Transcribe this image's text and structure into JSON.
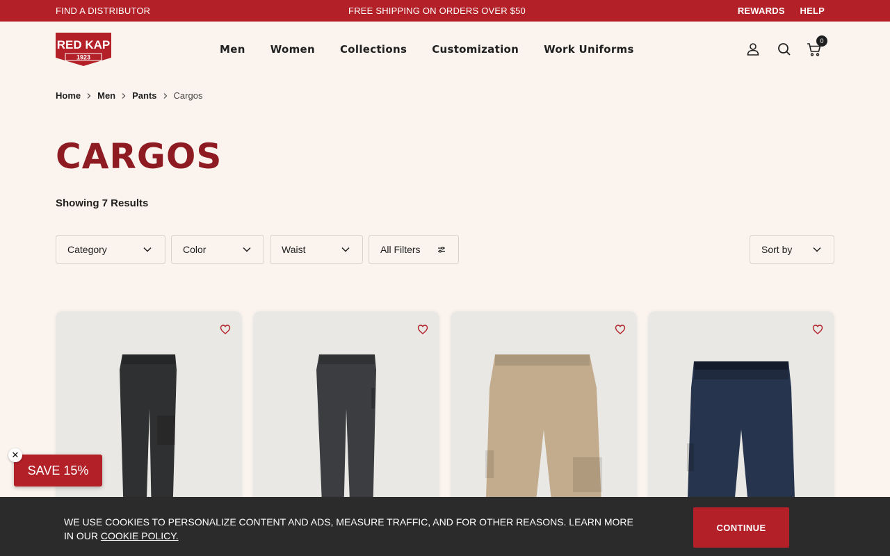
{
  "topbar": {
    "find_distributor": "FIND A DISTRIBUTOR",
    "shipping": "FREE SHIPPING ON ORDERS OVER $50",
    "rewards": "REWARDS",
    "help": "HELP"
  },
  "logo": {
    "line1": "RED KAP",
    "line2": "1923"
  },
  "nav": [
    "Men",
    "Women",
    "Collections",
    "Customization",
    "Work Uniforms"
  ],
  "cart": {
    "count": "0"
  },
  "breadcrumb": {
    "home": "Home",
    "men": "Men",
    "pants": "Pants",
    "current": "Cargos"
  },
  "page": {
    "title": "CARGOS",
    "results": "Showing 7 Results"
  },
  "filters": {
    "category": "Category",
    "color": "Color",
    "waist": "Waist",
    "all_filters": "All Filters",
    "sort": "Sort by"
  },
  "products": [
    {
      "color": "#2f3031"
    },
    {
      "color": "#3b3d40"
    },
    {
      "color": "#c3ac8d"
    },
    {
      "color": "#27344d"
    }
  ],
  "promo": {
    "label": "SAVE 15%",
    "close": "✕"
  },
  "cookie": {
    "text": "WE USE COOKIES TO PERSONALIZE CONTENT AND ADS, MEASURE TRAFFIC, AND FOR OTHER REASONS. LEARN MORE IN OUR ",
    "link": "COOKIE POLICY.",
    "button": "CONTINUE"
  },
  "colors": {
    "brand": "#b32027",
    "title": "#8e1b21",
    "background": "#fbf4ee"
  }
}
